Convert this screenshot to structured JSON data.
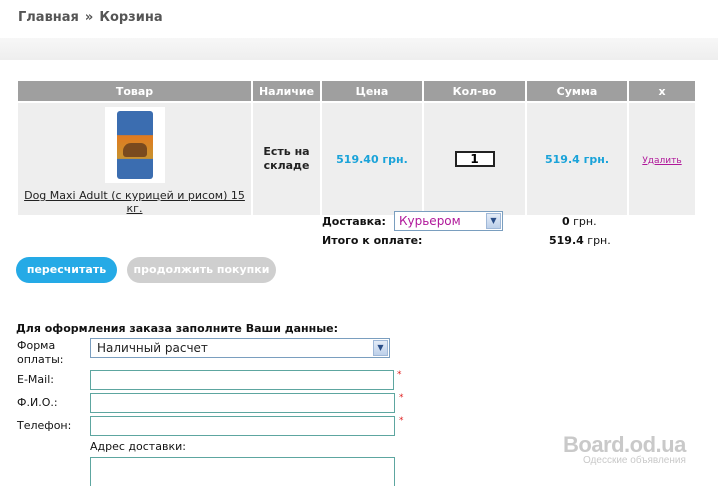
{
  "breadcrumb": {
    "home": "Главная",
    "separator": "»",
    "current": "Корзина"
  },
  "cart": {
    "headers": [
      "Товар",
      "Наличие",
      "Цена",
      "Кол-во",
      "Сумма",
      "x"
    ],
    "items": [
      {
        "name": "Dog Maxi Adult (с курицей и рисом) 15 кг.",
        "availability": "Есть на складе",
        "price": "519.40 грн.",
        "quantity": "1",
        "sum": "519.4 грн.",
        "delete_label": "Удалить"
      }
    ]
  },
  "delivery": {
    "label": "Доставка:",
    "selected": "Курьером",
    "cost_value": "0",
    "cost_unit": "грн."
  },
  "total": {
    "label": "Итого к оплате:",
    "value": "519.4",
    "unit": "грн."
  },
  "buttons": {
    "recalculate": "пересчитать",
    "continue_shopping": "продолжить покупки"
  },
  "form": {
    "title": "Для оформления заказа заполните Ваши данные:",
    "payment_label": "Форма оплаты:",
    "payment_selected": "Наличный расчет",
    "email_label": "E-Mail:",
    "name_label": "Ф.И.О.:",
    "phone_label": "Телефон:",
    "address_label": "Адрес доставки:",
    "required_mark": "*"
  },
  "watermark": {
    "main": "Board.od.ua",
    "sub": "Одесские объявления"
  },
  "colors": {
    "accent": "#1aa3d9",
    "button_blue": "#25aae6",
    "header_gray": "#9f9f9f",
    "link_magenta": "#b0189a",
    "required_red": "#e02020"
  }
}
